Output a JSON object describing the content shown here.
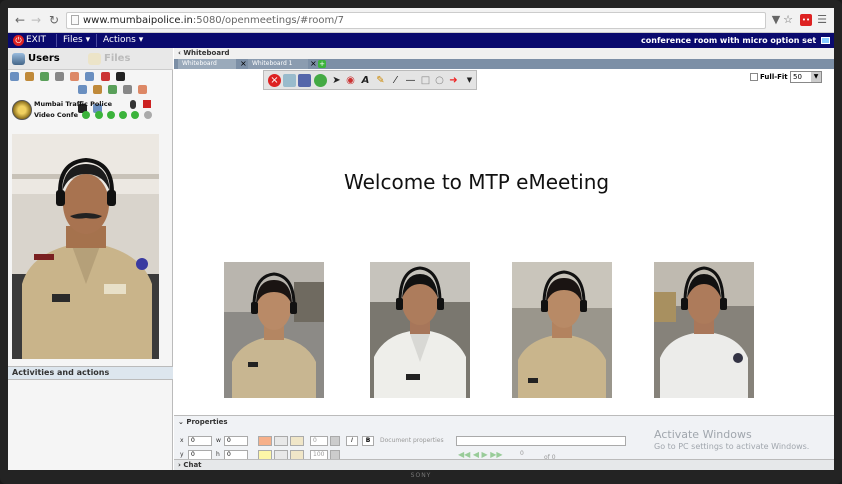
{
  "browser": {
    "url_domain": "www.mumbaipolice.in",
    "url_path": ":5080/openmeetings/#room/7"
  },
  "app_bar": {
    "exit_label": "EXIT",
    "files_label": "Files",
    "actions_label": "Actions",
    "room_title": "conference room with micro option set"
  },
  "left_panel": {
    "users_tab": "Users",
    "files_tab": "Files",
    "user_row_1": "Mumbai Traffic Police",
    "user_row_2": "Video Confe",
    "activities_label": "Activities and actions"
  },
  "whiteboard": {
    "header": "Whiteboard",
    "tab_1": "Whiteboard",
    "tab_2": "Whiteboard 1",
    "welcome_text": "Welcome to MTP eMeeting",
    "fullfit_label": "Full-Fit",
    "zoom_value": "50"
  },
  "properties": {
    "title": "Properties",
    "x_label": "x",
    "y_label": "y",
    "w_label": "w",
    "h_label": "h",
    "x_value": "0",
    "y_value": "0",
    "w_value": "0",
    "h_value": "0",
    "font_size": "0",
    "opacity": "100",
    "bold_label": "I",
    "italic_label": "B",
    "doc_props_label": "Document properties",
    "page_value": "0",
    "page_of": "of 0"
  },
  "watermark": {
    "line1": "Activate Windows",
    "line2": "Go to PC settings to activate Windows."
  },
  "chat_label": "Chat",
  "bezel_logo": "SONY"
}
